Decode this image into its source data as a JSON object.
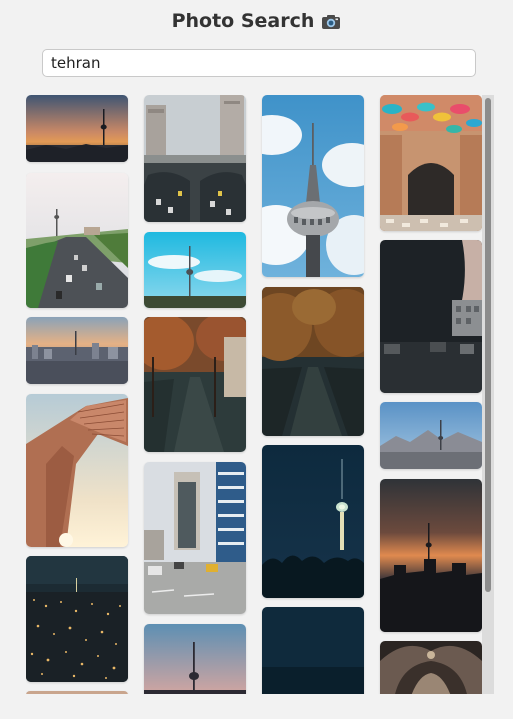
{
  "header": {
    "title": "Photo Search",
    "camera_icon": "camera-icon"
  },
  "search": {
    "value": "tehran",
    "placeholder": ""
  },
  "results": {
    "columns": [
      [
        {
          "name": "photo-tower-sunset-skyline",
          "icon": "milad-tower-sunset"
        },
        {
          "name": "photo-highway-tower-view",
          "icon": "highway-traffic"
        },
        {
          "name": "photo-city-dusk-panorama",
          "icon": "city-dusk"
        },
        {
          "name": "photo-azadi-tower-closeup",
          "icon": "azadi-tower"
        },
        {
          "name": "photo-city-night-lights",
          "icon": "city-night"
        },
        {
          "name": "photo-partial-bottom",
          "icon": "photo"
        }
      ],
      [
        {
          "name": "photo-overpass-traffic",
          "icon": "overpass-traffic"
        },
        {
          "name": "photo-tower-blue-sky",
          "icon": "milad-tower-day"
        },
        {
          "name": "photo-autumn-street",
          "icon": "autumn-street"
        },
        {
          "name": "photo-downtown-buildings",
          "icon": "downtown-buildings"
        },
        {
          "name": "photo-tower-twilight",
          "icon": "milad-tower-twilight"
        }
      ],
      [
        {
          "name": "photo-tower-clouds-closeup",
          "icon": "milad-tower-closeup"
        },
        {
          "name": "photo-autumn-road-dark",
          "icon": "autumn-road"
        },
        {
          "name": "photo-tower-night-lit",
          "icon": "milad-tower-night"
        },
        {
          "name": "photo-dark-blue-bottom",
          "icon": "photo"
        }
      ],
      [
        {
          "name": "photo-umbrella-alley",
          "icon": "umbrella-alley"
        },
        {
          "name": "photo-dark-building-shadow",
          "icon": "dark-building"
        },
        {
          "name": "photo-mountains-skyline",
          "icon": "mountain-skyline"
        },
        {
          "name": "photo-sunset-silhouette",
          "icon": "sunset-silhouette"
        },
        {
          "name": "photo-ceiling-arches",
          "icon": "ceiling-arches"
        }
      ]
    ]
  },
  "colors": {
    "background": "#f2f2f2",
    "title": "#333333",
    "input_border": "#c9c9c9",
    "scrollbar_thumb": "#8c8c8c",
    "scrollbar_track": "#dcdcdc"
  }
}
